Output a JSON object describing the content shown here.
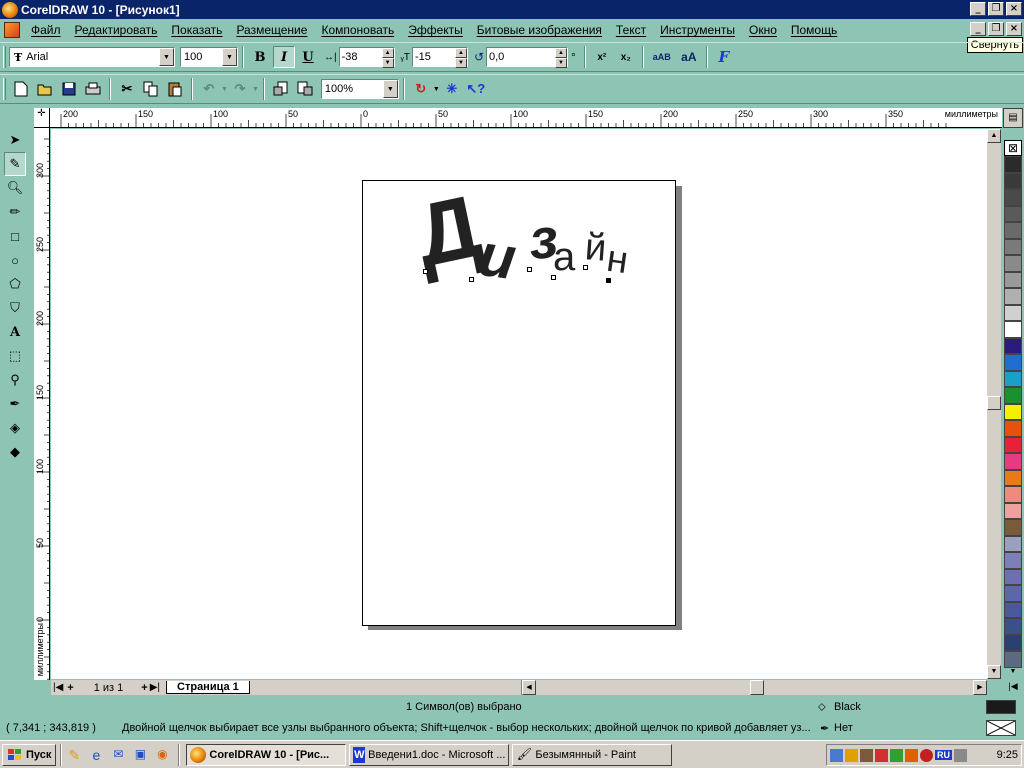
{
  "window": {
    "title": "CorelDRAW 10 - [Рисунок1]",
    "tooltip": "Свернуть"
  },
  "menu": [
    "Файл",
    "Редактировать",
    "Показать",
    "Размещение",
    "Компоновать",
    "Эффекты",
    "Битовые изображения",
    "Текст",
    "Инструменты",
    "Окно",
    "Помощь"
  ],
  "text_toolbar": {
    "font_icon": "Ŧ",
    "font_name": "Arial",
    "font_size": "100",
    "bold": "B",
    "italic": "I",
    "underline": "U",
    "kerning_value": "-38",
    "baseline_shift": "-15",
    "rotation": "0,0",
    "degree_sign": "°",
    "superscript": "x²",
    "subscript": "x₂",
    "case_small": "aAB",
    "case_change": "aA",
    "format_text": "F"
  },
  "standard_toolbar": {
    "zoom": "100%"
  },
  "ruler": {
    "h_ticks": [
      "200",
      "150",
      "100",
      "50",
      "0",
      "50",
      "100",
      "150",
      "200",
      "250",
      "300",
      "350"
    ],
    "h_unit": "миллиметры",
    "v_ticks": [
      "300",
      "250",
      "200",
      "150",
      "100",
      "50",
      "0"
    ],
    "v_unit": "миллиметры"
  },
  "document": {
    "glyphs": [
      {
        "ch": "Д",
        "rotate": -12,
        "size": 88
      },
      {
        "ch": "и",
        "rotate": 8,
        "size": 60
      },
      {
        "ch": "з",
        "rotate": -6,
        "size": 56
      },
      {
        "ch": "а",
        "rotate": 0,
        "size": 40
      },
      {
        "ch": "й",
        "rotate": 4,
        "size": 38
      },
      {
        "ch": "н",
        "rotate": 8,
        "size": 38
      }
    ]
  },
  "page_nav": {
    "page_count": "1 из 1",
    "page_tab": "Страница 1"
  },
  "status": {
    "selection": "1 Символ(ов) выбрано",
    "fill_name": "Black",
    "coords": "( 7,341 ; 343,819 )",
    "hint": "Двойной щелчок выбирает все узлы выбранного объекта; Shift+щелчок - выбор нескольких; двойной щелчок по кривой добавляет уз...",
    "outline_name": "Нет",
    "fill_color": "#1a1a1a"
  },
  "palette": [
    "#2b2b2b",
    "#3a3a3a",
    "#4a4a4a",
    "#5a5a5a",
    "#6a6a6a",
    "#7a7a7a",
    "#8a8a8a",
    "#9a9a9a",
    "#b0b0b0",
    "#d0d0d0",
    "#ffffff",
    "#2a1a7a",
    "#1f6fd0",
    "#1aa0c8",
    "#1a9030",
    "#f4f000",
    "#e85010",
    "#e8203a",
    "#e83a80",
    "#e87a1a",
    "#f08a80",
    "#f0a0a0",
    "#7a5a3a",
    "#9aa0c0",
    "#7a80b8",
    "#6a70b0",
    "#5a68a8",
    "#4a5a98",
    "#3a5088",
    "#2a4070",
    "#5a6a80"
  ],
  "taskbar": {
    "start": "Пуск",
    "tasks": [
      {
        "label": "CorelDRAW 10 - [Рис...",
        "active": true
      },
      {
        "label": "Введени1.doc - Microsoft ...",
        "active": false
      },
      {
        "label": "Безымянный - Paint",
        "active": false
      }
    ],
    "clock": "9:25",
    "lang": "RU"
  }
}
